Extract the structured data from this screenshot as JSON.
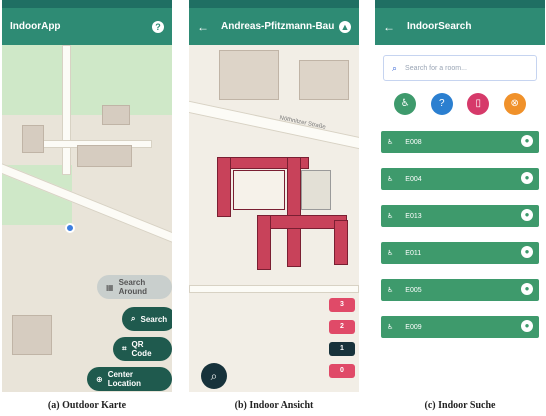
{
  "outdoor": {
    "title": "IndoorApp",
    "help_icon": "help-icon",
    "search_nearby_label": "Search Around",
    "search_label": "Search",
    "qr_label": "QR Code",
    "center_label": "Center Location",
    "caption": "(a) Outdoor Karte"
  },
  "indoor_view": {
    "title": "Andreas-Pfitzmann-Bau",
    "floor_chips": [
      "3",
      "2",
      "1",
      "0"
    ],
    "active_chip": "1",
    "street_label": "Nöthnitzer Straße",
    "caption": "(b) Indoor Ansicht"
  },
  "indoor_search": {
    "title": "IndoorSearch",
    "search_placeholder": "Search for a room...",
    "categories": [
      "toilet-icon",
      "info-icon",
      "exit-icon",
      "no-icon"
    ],
    "items": [
      "E008",
      "E004",
      "E013",
      "E011",
      "E005",
      "E009"
    ],
    "caption": "(c) Indoor Suche"
  },
  "colors": {
    "appbar": "#2e8b74",
    "dark_button": "#1f5a4e",
    "list_item": "#3e9a6c",
    "floor_room": "#c8425a"
  }
}
